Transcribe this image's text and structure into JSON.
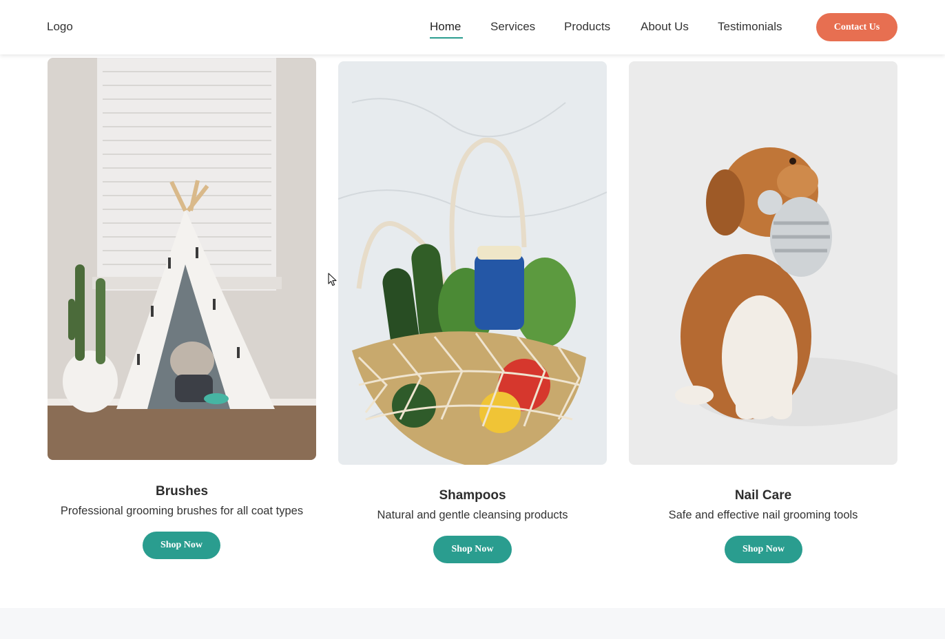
{
  "nav": {
    "logo": "Logo",
    "links": [
      "Home",
      "Services",
      "Products",
      "About Us",
      "Testimonials"
    ],
    "active": "Home",
    "contact_label": "Contact Us"
  },
  "products": [
    {
      "title": "Brushes",
      "description": "Professional grooming brushes for all coat types",
      "button": "Shop Now",
      "image": "french-bulldog-in-cactus-teepee-photo"
    },
    {
      "title": "Shampoos",
      "description": "Natural and gentle cleansing products",
      "button": "Shop Now",
      "image": "mesh-grocery-bag-on-marble-photo"
    },
    {
      "title": "Nail Care",
      "description": "Safe and effective nail grooming tools",
      "button": "Shop Now",
      "image": "golden-dog-holding-plush-toy-photo"
    }
  ],
  "colors": {
    "accent": "#e76f51",
    "primary": "#2a9d8f",
    "footer_band": "#f6f7f9"
  }
}
